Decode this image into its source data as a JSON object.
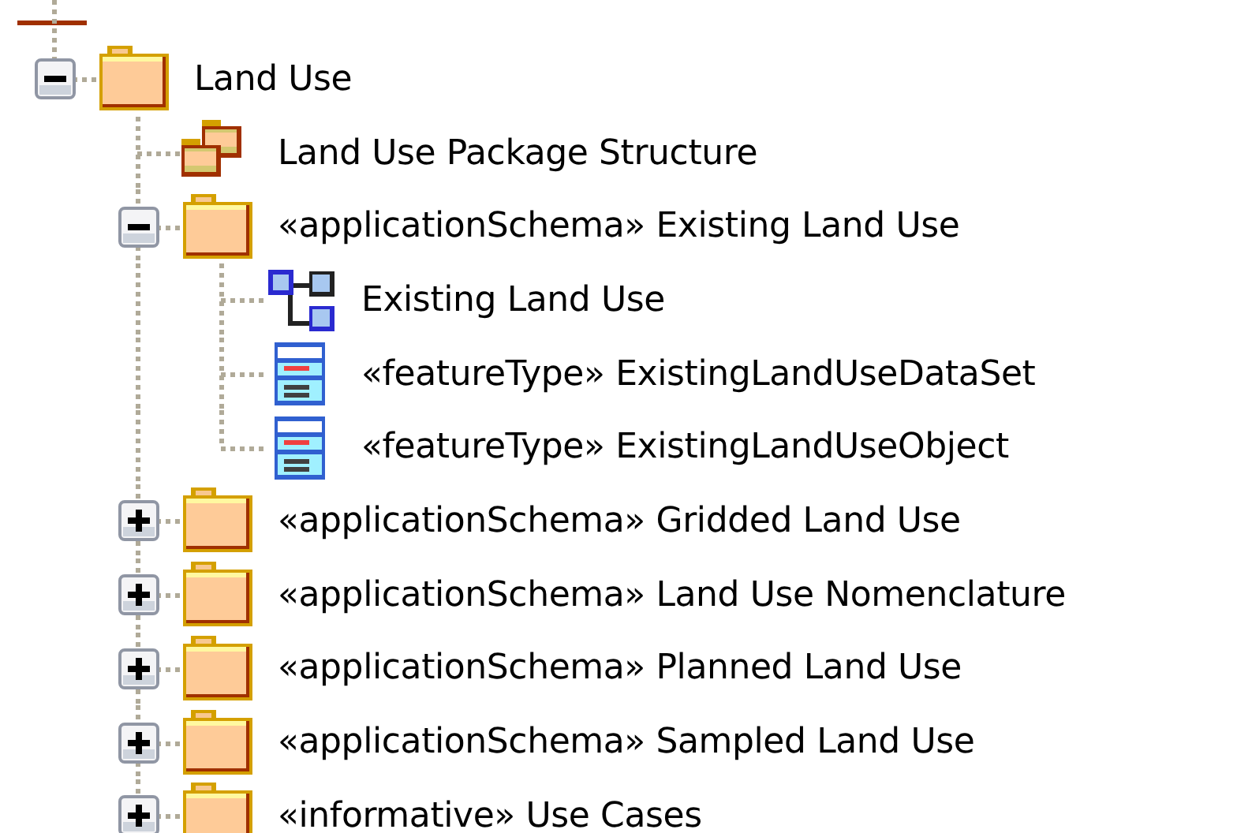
{
  "tree": [
    {
      "label": "Land Use",
      "kind": "folder",
      "expanded": true,
      "children": [
        {
          "label": "Land Use Package Structure",
          "kind": "package"
        },
        {
          "label": "«applicationSchema» Existing Land Use",
          "kind": "folder",
          "expanded": true,
          "children": [
            {
              "label": "Existing Land Use",
              "kind": "diagram"
            },
            {
              "label": "«featureType» ExistingLandUseDataSet",
              "kind": "class"
            },
            {
              "label": "«featureType» ExistingLandUseObject",
              "kind": "class"
            }
          ]
        },
        {
          "label": "«applicationSchema» Gridded Land Use",
          "kind": "folder",
          "expanded": false
        },
        {
          "label": "«applicationSchema» Land Use Nomenclature",
          "kind": "folder",
          "expanded": false
        },
        {
          "label": "«applicationSchema» Planned Land Use",
          "kind": "folder",
          "expanded": false
        },
        {
          "label": "«applicationSchema» Sampled Land Use",
          "kind": "folder",
          "expanded": false
        },
        {
          "label": "«informative» Use Cases",
          "kind": "folder",
          "expanded": false
        }
      ]
    }
  ]
}
